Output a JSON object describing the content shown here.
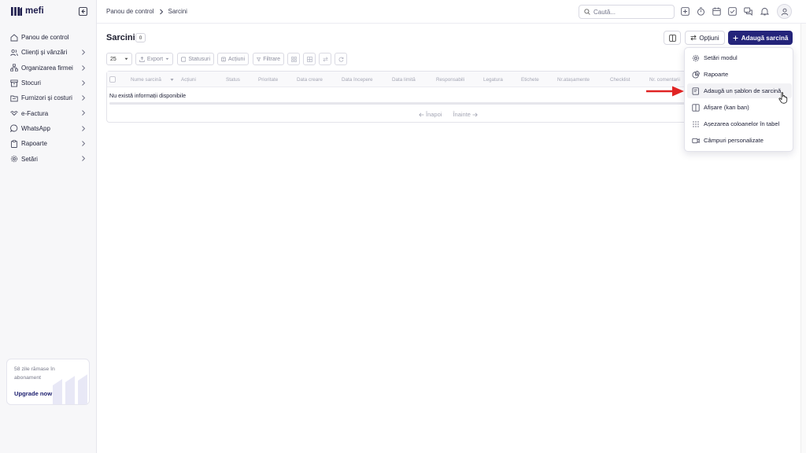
{
  "app": {
    "logo_text": "mefi"
  },
  "sidebar": {
    "items": [
      {
        "label": "Panou de control",
        "icon": "home-icon",
        "has_children": false
      },
      {
        "label": "Clienți și vânzări",
        "icon": "users-icon",
        "has_children": true
      },
      {
        "label": "Organizarea firmei",
        "icon": "org-icon",
        "has_children": true
      },
      {
        "label": "Stocuri",
        "icon": "box-icon",
        "has_children": true
      },
      {
        "label": "Furnizori și costuri",
        "icon": "folder-icon",
        "has_children": true
      },
      {
        "label": "e-Factura",
        "icon": "handshake-icon",
        "has_children": true
      },
      {
        "label": "WhatsApp",
        "icon": "whatsapp-icon",
        "has_children": true
      },
      {
        "label": "Rapoarte",
        "icon": "clipboard-icon",
        "has_children": true
      },
      {
        "label": "Setări",
        "icon": "gear-icon",
        "has_children": true
      }
    ],
    "promo": {
      "text": "58 zile rămase în abonament",
      "link": "Upgrade now"
    }
  },
  "header": {
    "breadcrumb": [
      "Panou de control",
      "Sarcini"
    ],
    "search_placeholder": "Caută..."
  },
  "main": {
    "title": "Sarcini",
    "count": "0",
    "options_label": "Opțiuni",
    "add_label": "Adaugă sarcină",
    "toolbar": {
      "page_size": "25",
      "export": "Export",
      "statuses": "Statusuri",
      "actions": "Acțiuni",
      "filter": "Filtrare"
    },
    "table": {
      "columns": [
        "Nume sarcină",
        "Acțiuni",
        "Status",
        "Prioritate",
        "Data creare",
        "Data începere",
        "Data limită",
        "Responsabili",
        "Legatura",
        "Etichete",
        "Nr.atașamente",
        "Checklist",
        "Nr. comentarii"
      ],
      "empty_text": "Nu există informații disponibile"
    },
    "pagination": {
      "prev": "Înapoi",
      "next": "Înainte"
    }
  },
  "dropdown": {
    "items": [
      {
        "label": "Setări modul",
        "icon": "gear-icon"
      },
      {
        "label": "Rapoarte",
        "icon": "pie-chart-icon"
      },
      {
        "label": "Adaugă un șablon de sarcină",
        "icon": "template-icon"
      },
      {
        "label": "Afișare (kan ban)",
        "icon": "kanban-icon"
      },
      {
        "label": "Așezarea coloanelor în tabel",
        "icon": "grip-icon"
      },
      {
        "label": "Câmpuri personalizate",
        "icon": "custom-fields-icon"
      }
    ]
  },
  "colors": {
    "primary": "#24247a",
    "annotation_arrow": "#e02424"
  }
}
